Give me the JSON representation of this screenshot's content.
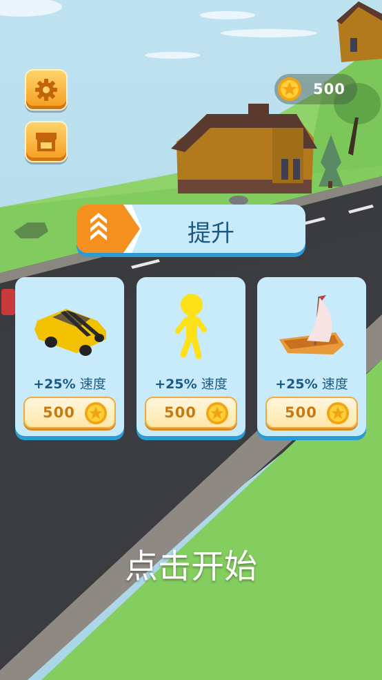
{
  "hud": {
    "coin_count": "500"
  },
  "upgrade": {
    "title": "提升"
  },
  "cards": [
    {
      "desc_pct": "+25%",
      "desc_stat": "速度",
      "price": "500",
      "art": "car-icon"
    },
    {
      "desc_pct": "+25%",
      "desc_stat": "速度",
      "price": "500",
      "art": "runner-icon"
    },
    {
      "desc_pct": "+25%",
      "desc_stat": "速度",
      "price": "500",
      "art": "sailboat-icon"
    }
  ],
  "start_prompt": "点击开始",
  "colors": {
    "button_orange": "#f59b1d",
    "panel_blue": "#c7ebfa",
    "panel_border_blue": "#2b9bd4",
    "text_blue": "#1c5a82",
    "price_orange": "#c77a14"
  }
}
